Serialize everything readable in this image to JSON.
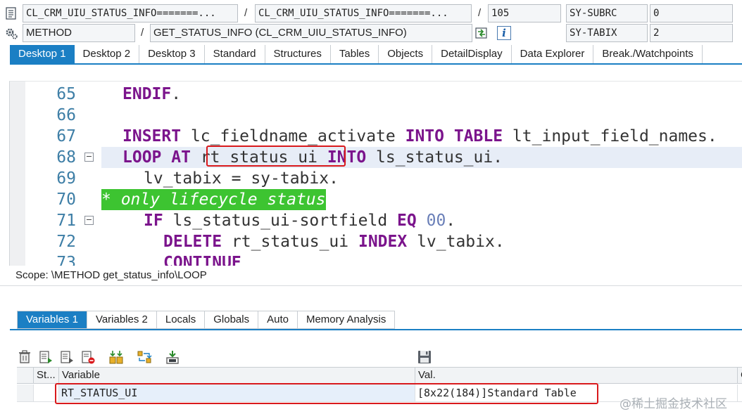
{
  "header": {
    "row1": {
      "program": "CL_CRM_UIU_STATUS_INFO=======...",
      "include": "CL_CRM_UIU_STATUS_INFO=======...",
      "line": "105",
      "sysvar_name": "SY-SUBRC",
      "sysvar_value": "0"
    },
    "row2": {
      "event_type": "METHOD",
      "event_name": "GET_STATUS_INFO (CL_CRM_UIU_STATUS_INFO)",
      "sysvar_name": "SY-TABIX",
      "sysvar_value": "2"
    },
    "separator": "/",
    "info_icon_text": "i"
  },
  "desktop_tabs": [
    {
      "label": "Desktop 1",
      "active": true
    },
    {
      "label": "Desktop 2",
      "active": false
    },
    {
      "label": "Desktop 3",
      "active": false
    },
    {
      "label": "Standard",
      "active": false
    },
    {
      "label": "Structures",
      "active": false
    },
    {
      "label": "Tables",
      "active": false
    },
    {
      "label": "Objects",
      "active": false
    },
    {
      "label": "DetailDisplay",
      "active": false
    },
    {
      "label": "Data Explorer",
      "active": false
    },
    {
      "label": "Break./Watchpoints",
      "active": false
    }
  ],
  "code": {
    "line_numbers": [
      "65",
      "66",
      "67",
      "68",
      "69",
      "70",
      "71",
      "72",
      "73"
    ],
    "l65": {
      "kw": "ENDIF",
      "rest": "."
    },
    "l67": {
      "kw1": "INSERT",
      "t1": " lc_fieldname_activate ",
      "kw2": "INTO TABLE",
      "t2": " lt_input_field_names."
    },
    "l68": {
      "kw1": "LOOP AT",
      "t1": " rt_status_ui ",
      "kw2": "INTO",
      "t2": " ls_status_ui."
    },
    "l69": {
      "text": "lv_tabix = sy-tabix."
    },
    "l70": {
      "comment": "* only lifecycle status"
    },
    "l71": {
      "kw1": "IF",
      "t1": " ls_status_ui-sortfield ",
      "kw2": "EQ",
      "num": " 00",
      "t2": "."
    },
    "l72": {
      "kw1": "DELETE",
      "t1": " rt_status_ui ",
      "kw2": "INDEX",
      "t2": " lv_tabix."
    },
    "l73": {
      "kw": "CONTINUE"
    },
    "fold_symbol": "−"
  },
  "scope": "Scope: \\METHOD get_status_info\\LOOP",
  "variable_tabs": [
    {
      "label": "Variables 1",
      "active": true
    },
    {
      "label": "Variables 2",
      "active": false
    },
    {
      "label": "Locals",
      "active": false
    },
    {
      "label": "Globals",
      "active": false
    },
    {
      "label": "Auto",
      "active": false
    },
    {
      "label": "Memory Analysis",
      "active": false
    }
  ],
  "grid": {
    "headers": {
      "status": "St...",
      "variable": "Variable",
      "value": "Val.",
      "extra": "C"
    },
    "rows": [
      {
        "variable": "RT_STATUS_UI",
        "value": "[8x22(184)]Standard Table"
      }
    ]
  },
  "watermark": "@稀土掘金技术社区",
  "colors": {
    "accent": "#1b7fc4",
    "keyword": "#7b148c",
    "comment_bg": "#3dc431",
    "highlight_box": "#d9191c"
  }
}
